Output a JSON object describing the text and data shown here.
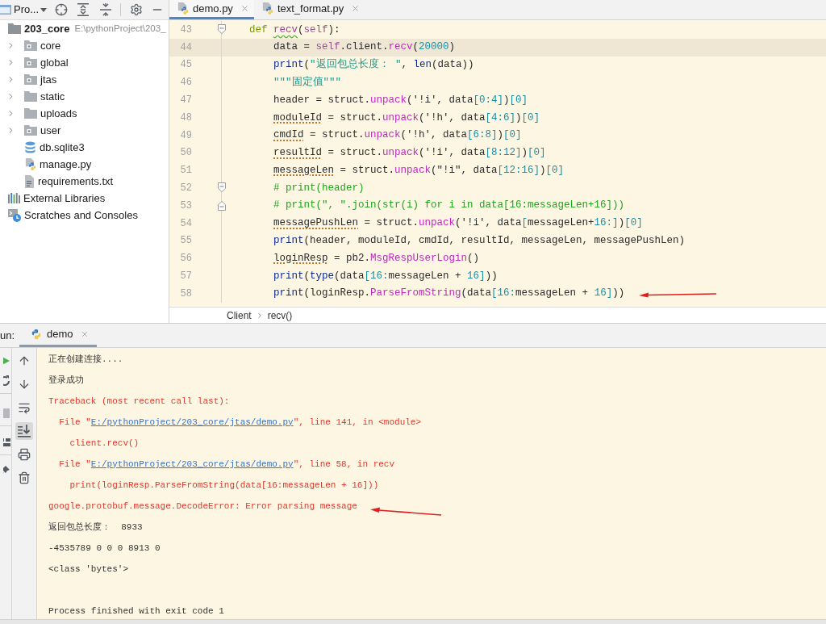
{
  "project_panel": {
    "title": "Pro...",
    "tree": [
      {
        "label": "203_core",
        "path": "E:\\pythonProject\\203_",
        "kind": "project-root",
        "children": [
          {
            "label": "core",
            "kind": "package",
            "expanded": false
          },
          {
            "label": "global",
            "kind": "package",
            "expanded": false
          },
          {
            "label": "jtas",
            "kind": "package",
            "expanded": false
          },
          {
            "label": "static",
            "kind": "folder",
            "expanded": false
          },
          {
            "label": "uploads",
            "kind": "folder",
            "expanded": false
          },
          {
            "label": "user",
            "kind": "package",
            "expanded": false
          },
          {
            "label": "db.sqlite3",
            "kind": "database"
          },
          {
            "label": "manage.py",
            "kind": "python"
          },
          {
            "label": "requirements.txt",
            "kind": "text"
          }
        ]
      },
      {
        "label": "External Libraries",
        "kind": "libraries"
      },
      {
        "label": "Scratches and Consoles",
        "kind": "scratches"
      }
    ]
  },
  "editor": {
    "tabs": [
      {
        "label": "demo.py",
        "selected": true
      },
      {
        "label": "text_format.py",
        "selected": false
      }
    ],
    "lines": [
      {
        "number": "43",
        "fold_start": true,
        "fold_end": false,
        "current": false,
        "tokens": [
          {
            "text": "def ",
            "kind": "keyword"
          },
          {
            "text": "recv",
            "kind": "function-typo"
          },
          {
            "text": "(",
            "kind": "plain"
          },
          {
            "text": "self",
            "kind": "self"
          },
          {
            "text": "):",
            "kind": "plain"
          }
        ],
        "children": [
          {
            "number": "44",
            "fold_start": false,
            "fold_end": false,
            "current": true,
            "tokens": [
              {
                "text": "data = ",
                "kind": "plain"
              },
              {
                "text": "self",
                "kind": "self"
              },
              {
                "text": ".client.",
                "kind": "plain"
              },
              {
                "text": "recv",
                "kind": "call"
              },
              {
                "text": "(",
                "kind": "plain"
              },
              {
                "text": "20000",
                "kind": "number"
              },
              {
                "text": ")",
                "kind": "plain"
              }
            ]
          },
          {
            "number": "45",
            "fold_start": false,
            "fold_end": false,
            "current": false,
            "tokens": [
              {
                "text": "print",
                "kind": "builtin"
              },
              {
                "text": "(",
                "kind": "plain"
              },
              {
                "text": "\"返回包总长度： \"",
                "kind": "string"
              },
              {
                "text": ", ",
                "kind": "plain"
              },
              {
                "text": "len",
                "kind": "builtin"
              },
              {
                "text": "(data))",
                "kind": "plain"
              }
            ]
          },
          {
            "number": "46",
            "fold_start": false,
            "fold_end": false,
            "current": false,
            "tokens": [
              {
                "text": "\"\"\"固定值\"\"\"",
                "kind": "string"
              }
            ]
          },
          {
            "number": "47",
            "fold_start": false,
            "fold_end": false,
            "current": false,
            "tokens": [
              {
                "text": "header = struct.",
                "kind": "plain"
              },
              {
                "text": "unpack",
                "kind": "call"
              },
              {
                "text": "('!i', data",
                "kind": "plain"
              },
              {
                "text": "[0:4]",
                "kind": "number"
              },
              {
                "text": ")",
                "kind": "plain"
              },
              {
                "text": "[0]",
                "kind": "number"
              }
            ]
          },
          {
            "number": "48",
            "fold_start": false,
            "fold_end": false,
            "current": false,
            "tokens": [
              {
                "text": "moduleId",
                "kind": "variable-warning"
              },
              {
                "text": " = struct.",
                "kind": "plain"
              },
              {
                "text": "unpack",
                "kind": "call"
              },
              {
                "text": "('!h', data",
                "kind": "plain"
              },
              {
                "text": "[4:6]",
                "kind": "number"
              },
              {
                "text": ")",
                "kind": "plain"
              },
              {
                "text": "[0]",
                "kind": "number"
              }
            ]
          },
          {
            "number": "49",
            "fold_start": false,
            "fold_end": false,
            "current": false,
            "tokens": [
              {
                "text": "cmdId",
                "kind": "variable-warning"
              },
              {
                "text": " = struct.",
                "kind": "plain"
              },
              {
                "text": "unpack",
                "kind": "call"
              },
              {
                "text": "('!h', data",
                "kind": "plain"
              },
              {
                "text": "[6:8]",
                "kind": "number"
              },
              {
                "text": ")",
                "kind": "plain"
              },
              {
                "text": "[0]",
                "kind": "number"
              }
            ]
          },
          {
            "number": "50",
            "fold_start": false,
            "fold_end": false,
            "current": false,
            "tokens": [
              {
                "text": "resultId",
                "kind": "variable-warning"
              },
              {
                "text": " = struct.",
                "kind": "plain"
              },
              {
                "text": "unpack",
                "kind": "call"
              },
              {
                "text": "('!i', data",
                "kind": "plain"
              },
              {
                "text": "[8:12]",
                "kind": "number"
              },
              {
                "text": ")",
                "kind": "plain"
              },
              {
                "text": "[0]",
                "kind": "number"
              }
            ]
          },
          {
            "number": "51",
            "fold_start": false,
            "fold_end": false,
            "current": false,
            "tokens": [
              {
                "text": "messageLen",
                "kind": "variable-warning"
              },
              {
                "text": " = struct.",
                "kind": "plain"
              },
              {
                "text": "unpack",
                "kind": "call"
              },
              {
                "text": "(\"!i\", data",
                "kind": "plain"
              },
              {
                "text": "[12:16]",
                "kind": "number"
              },
              {
                "text": ")",
                "kind": "plain"
              },
              {
                "text": "[0]",
                "kind": "number"
              }
            ]
          },
          {
            "number": "52",
            "fold_start": true,
            "fold_end": false,
            "current": false,
            "tokens": [
              {
                "text": "# print(header)",
                "kind": "comment"
              }
            ]
          },
          {
            "number": "53",
            "fold_start": false,
            "fold_end": true,
            "current": false,
            "tokens": [
              {
                "text": "# print(\", \".join(str(i) for i in data[16:messageLen+16]))",
                "kind": "comment"
              }
            ]
          },
          {
            "number": "54",
            "fold_start": false,
            "fold_end": false,
            "current": false,
            "tokens": [
              {
                "text": "messagePushLen",
                "kind": "variable-warning"
              },
              {
                "text": " = struct.",
                "kind": "plain"
              },
              {
                "text": "unpack",
                "kind": "call"
              },
              {
                "text": "('!i', data",
                "kind": "plain"
              },
              {
                "text": "[",
                "kind": "number"
              },
              {
                "text": "messageLen+",
                "kind": "plain"
              },
              {
                "text": "16:]",
                "kind": "number"
              },
              {
                "text": ")",
                "kind": "plain"
              },
              {
                "text": "[0]",
                "kind": "number"
              }
            ]
          },
          {
            "number": "55",
            "fold_start": false,
            "fold_end": false,
            "current": false,
            "tokens": [
              {
                "text": "print",
                "kind": "builtin"
              },
              {
                "text": "(header, moduleId, cmdId, resultId, messageLen, messagePushLen)",
                "kind": "plain"
              }
            ]
          },
          {
            "number": "56",
            "fold_start": false,
            "fold_end": false,
            "current": false,
            "tokens": [
              {
                "text": "loginResp",
                "kind": "variable-warning"
              },
              {
                "text": " = pb2.",
                "kind": "plain"
              },
              {
                "text": "MsgRespUserLogin",
                "kind": "call"
              },
              {
                "text": "()",
                "kind": "plain"
              }
            ]
          },
          {
            "number": "57",
            "fold_start": false,
            "fold_end": false,
            "current": false,
            "tokens": [
              {
                "text": "print",
                "kind": "builtin"
              },
              {
                "text": "(",
                "kind": "plain"
              },
              {
                "text": "type",
                "kind": "builtin"
              },
              {
                "text": "(data",
                "kind": "plain"
              },
              {
                "text": "[16:",
                "kind": "number"
              },
              {
                "text": "messageLen + ",
                "kind": "plain"
              },
              {
                "text": "16]",
                "kind": "number"
              },
              {
                "text": "))",
                "kind": "plain"
              }
            ]
          },
          {
            "number": "58",
            "fold_start": false,
            "fold_end": false,
            "current": false,
            "tokens": [
              {
                "text": "print",
                "kind": "builtin"
              },
              {
                "text": "(loginResp.",
                "kind": "plain"
              },
              {
                "text": "ParseFromString",
                "kind": "call"
              },
              {
                "text": "(data",
                "kind": "plain"
              },
              {
                "text": "[16:",
                "kind": "number"
              },
              {
                "text": "messageLen + ",
                "kind": "plain"
              },
              {
                "text": "16]",
                "kind": "number"
              },
              {
                "text": "))",
                "kind": "plain"
              }
            ]
          }
        ]
      }
    ],
    "breadcrumbs": [
      "Client",
      "recv()"
    ]
  },
  "run_panel": {
    "label": "un:",
    "tabs": [
      {
        "label": "demo",
        "selected": true
      }
    ],
    "toolbar": [
      {
        "kind": "up",
        "on": false
      },
      {
        "kind": "down",
        "on": false
      },
      {
        "kind": "wrap",
        "on": false
      },
      {
        "kind": "scroll-end",
        "on": true
      },
      {
        "kind": "print",
        "on": false
      },
      {
        "kind": "trash",
        "on": false
      }
    ],
    "console": [
      {
        "kind": "output",
        "parts": [
          {
            "text": "正在创建连接....",
            "kind": "stdout"
          }
        ]
      },
      {
        "kind": "output",
        "parts": [
          {
            "text": "登录成功",
            "kind": "stdout"
          }
        ]
      },
      {
        "kind": "output",
        "parts": [
          {
            "text": "Traceback (most recent call last):",
            "kind": "stderr"
          }
        ],
        "children": [
          {
            "kind": "output",
            "parts": [
              {
                "text": "File \"",
                "kind": "stderr"
              },
              {
                "text": "E:/pythonProject/203_core/jtas/demo.py",
                "kind": "link"
              },
              {
                "text": "\", line 141, in <module>",
                "kind": "stderr"
              }
            ],
            "children": [
              {
                "kind": "output",
                "parts": [
                  {
                    "text": "client.recv()",
                    "kind": "stderr"
                  }
                ]
              }
            ]
          },
          {
            "kind": "output",
            "parts": [
              {
                "text": "File \"",
                "kind": "stderr"
              },
              {
                "text": "E:/pythonProject/203_core/jtas/demo.py",
                "kind": "link"
              },
              {
                "text": "\", line 58, in recv",
                "kind": "stderr"
              }
            ],
            "children": [
              {
                "kind": "output",
                "parts": [
                  {
                    "text": "print(loginResp.ParseFromString(data[16:messageLen + 16]))",
                    "kind": "stderr"
                  }
                ]
              }
            ]
          }
        ]
      },
      {
        "kind": "output",
        "parts": [
          {
            "text": "google.protobuf.message.DecodeError: Error parsing message",
            "kind": "stderr"
          }
        ]
      },
      {
        "kind": "output",
        "parts": [
          {
            "text": "返回包总长度：  8933",
            "kind": "stdout"
          }
        ]
      },
      {
        "kind": "output",
        "parts": [
          {
            "text": "-4535789 0 0 0 8913 0",
            "kind": "stdout"
          }
        ]
      },
      {
        "kind": "output",
        "parts": [
          {
            "text": "<class 'bytes'>",
            "kind": "stdout"
          }
        ]
      },
      {
        "kind": "exit",
        "parts": [
          {
            "text": "Process finished with exit code 1",
            "kind": "stdout"
          }
        ]
      }
    ]
  }
}
